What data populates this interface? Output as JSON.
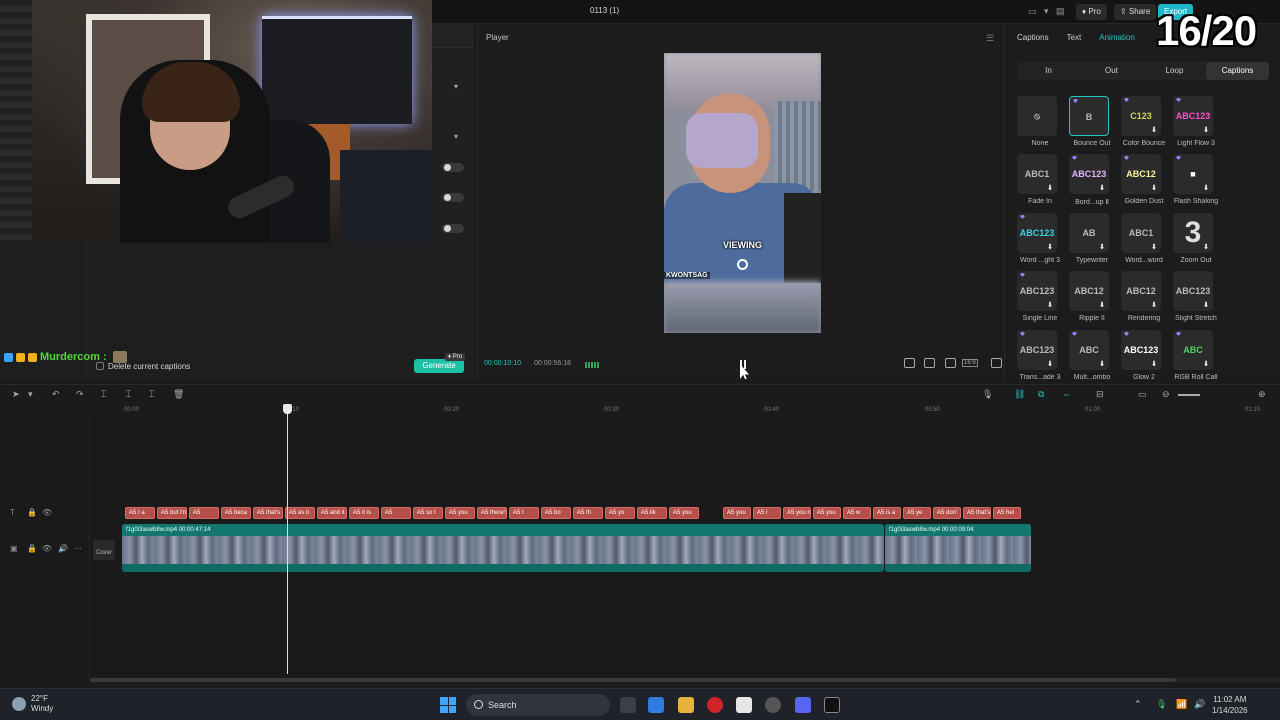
{
  "topbar": {
    "project_title": "0113 (1)",
    "pro_label": "Pro",
    "share_label": "Share",
    "export_label": "Export"
  },
  "overlay": {
    "counter": "16/20",
    "chat_user": "Murdercom :"
  },
  "left_panel": {
    "delete_captions_label": "Delete current captions",
    "generate_label": "Generate",
    "pro_badge": "Pro"
  },
  "player": {
    "label": "Player",
    "current_time": "00:00:10:10",
    "total_time": "00:00:56:18",
    "caption_main": "VIEWING",
    "caption_small": "KWONTSAG",
    "aspect_ratio": "16:9"
  },
  "right_panel": {
    "tabs": [
      "Captions",
      "Text",
      "Animation"
    ],
    "active_tab": "Animation",
    "subtabs": [
      "In",
      "Out",
      "Loop",
      "Captions"
    ],
    "active_subtab": "Captions",
    "presets": [
      {
        "preview": "⦸",
        "label": "None"
      },
      {
        "preview": "B",
        "label": "Bounce Out"
      },
      {
        "preview": "C123",
        "label": "Color Bounce"
      },
      {
        "preview": "ABC123",
        "label": "Light Flow 3"
      },
      {
        "preview": "ABC1",
        "label": "Fade In"
      },
      {
        "preview": "ABC123",
        "label": "Bord...up Ⅱ"
      },
      {
        "preview": "ABC12",
        "label": "Golden Dust"
      },
      {
        "preview": "■",
        "label": "Flash Shaking"
      },
      {
        "preview": "ABC123",
        "label": "Word ...ght 3"
      },
      {
        "preview": "AB",
        "label": "Typewriter"
      },
      {
        "preview": "ABC1",
        "label": "Word...word"
      },
      {
        "preview": "3",
        "label": "Zoom Out"
      },
      {
        "preview": "ABC123",
        "label": "Single Line"
      },
      {
        "preview": "ABC12",
        "label": "Ripple II"
      },
      {
        "preview": "ABC12",
        "label": "Rendering"
      },
      {
        "preview": "ABC123",
        "label": "Slight Stretch"
      },
      {
        "preview": "ABC123",
        "label": "Trans...ade 3"
      },
      {
        "preview": "ABC",
        "label": "Mult...ombo"
      },
      {
        "preview": "ABC123",
        "label": "Glow 2"
      },
      {
        "preview": "ABC",
        "label": "RGB Roll Call"
      }
    ]
  },
  "timeline": {
    "ruler": [
      "00:00",
      "00:10",
      "00:20",
      "00:30",
      "00:40",
      "00:50",
      "01:00",
      "01:10"
    ],
    "cover_label": "Cover",
    "captions": [
      "A5 I a",
      "A5 but I'm g",
      "A5",
      "A5 beca",
      "A5 that's",
      "A5 as it",
      "A5 and it",
      "A5 it is",
      "A5",
      "A5 so I",
      "A5 you",
      "A5 there's",
      "A5 I",
      "A5 bo",
      "A5 th",
      "A5 yo",
      "A5 lik",
      "A5 you",
      "A5 you",
      "A5 I",
      "A5 you m",
      "A5 you",
      "A5 w",
      "A5 is a",
      "A5 ye",
      "A5 don'",
      "A5 that's",
      "A5 hel"
    ],
    "clips": [
      {
        "name": "f1g0i3aswb8w.mp4",
        "duration": "00:00:47:14"
      },
      {
        "name": "f1g0i3aswb8w.mp4",
        "duration": "00:00:09:04"
      }
    ]
  },
  "taskbar": {
    "temperature": "22°F",
    "condition": "Windy",
    "search_label": "Search",
    "time": "11:02 AM",
    "date": "1/14/2026"
  },
  "colors": {
    "accent": "#26c6c6",
    "caption_clip": "#b44f4a",
    "video_clip": "#137f76",
    "generate": "#1bc0a7"
  }
}
